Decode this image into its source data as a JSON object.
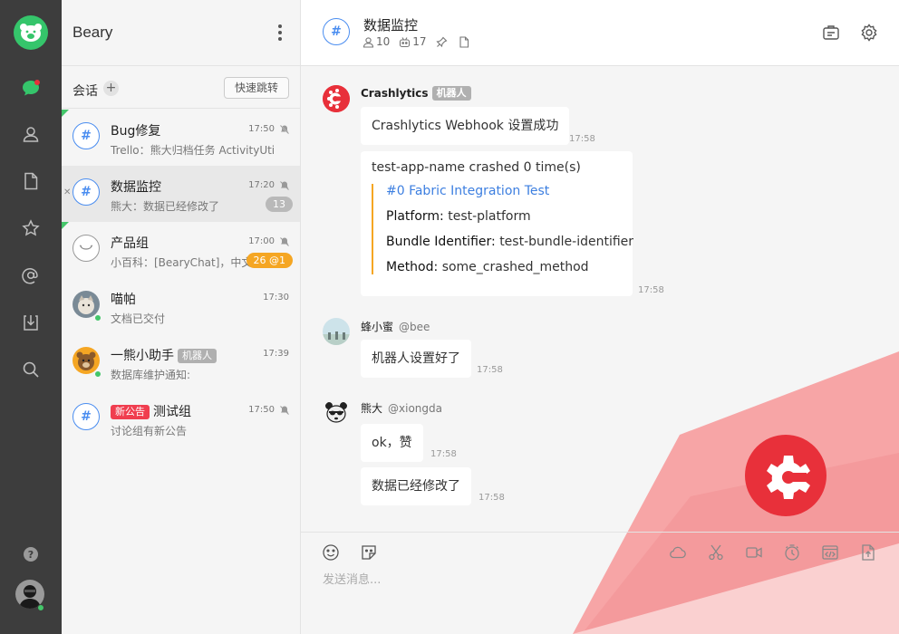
{
  "colors": {
    "accent": "#4a8df0",
    "brand": "#35c56b",
    "rail": "#3d3d3d",
    "alert": "#e8303a",
    "badge_orange": "#f5a623"
  },
  "rail": {
    "icons": [
      "bear-logo-icon",
      "chat-icon",
      "contacts-icon",
      "files-icon",
      "star-icon",
      "mention-icon",
      "download-icon",
      "search-icon",
      "help-icon"
    ],
    "help_label": "?"
  },
  "sidebar": {
    "team_name": "Beary",
    "section_title": "会话",
    "jump_button": "快速跳转",
    "channels": [
      {
        "name": "Bug修复",
        "preview": "Trello：熊大归档任务 ActivityUtil",
        "time": "17:50",
        "muted": true,
        "icon": "#"
      },
      {
        "name": "数据监控",
        "preview": "熊大：数据已经修改了",
        "time": "17:20",
        "muted": true,
        "unread": "13",
        "icon": "#"
      },
      {
        "name": "产品组",
        "preview": "小百科：[BearyChat]，中文字",
        "time": "17:00",
        "muted": true,
        "unread": "26 @1"
      },
      {
        "name": "喵帕",
        "preview": "文档已交付",
        "time": "17:30"
      },
      {
        "name": "一熊小助手",
        "tag": "机器人",
        "preview": "数据库维护通知:",
        "time": "17:39"
      },
      {
        "name": "测试组",
        "tag": "新公告",
        "preview": "讨论组有新公告",
        "time": "17:50",
        "muted": true,
        "icon": "#"
      }
    ]
  },
  "header": {
    "title": "数据监控",
    "members": "10",
    "bots": "17",
    "icon": "#"
  },
  "messages": [
    {
      "sender": "Crashlytics",
      "tag": "机器人",
      "text": "Crashlytics Webhook 设置成功",
      "time": "17:58"
    },
    {
      "text": "test-app-name crashed 0 time(s)",
      "time": "17:58",
      "attachment": {
        "title": "#0 Fabric Integration Test",
        "platform_key": "Platform:",
        "platform_val": "test-platform",
        "bundle_key": "Bundle Identifier:",
        "bundle_val": "test-bundle-identifier",
        "method_key": "Method:",
        "method_val": "some_crashed_method"
      }
    },
    {
      "sender": "蜂小蜜",
      "handle": "@bee",
      "text": "机器人设置好了",
      "time": "17:58"
    },
    {
      "sender": "熊大",
      "handle": "@xiongda",
      "text": "ok，赞",
      "time": "17:58"
    },
    {
      "text": "数据已经修改了",
      "time": "17:58"
    }
  ],
  "composer": {
    "placeholder": "发送消息...",
    "tools": [
      "emoji-icon",
      "sticker-icon",
      "cloud-icon",
      "scissors-icon",
      "video-icon",
      "timer-icon",
      "code-icon",
      "upload-icon"
    ]
  }
}
